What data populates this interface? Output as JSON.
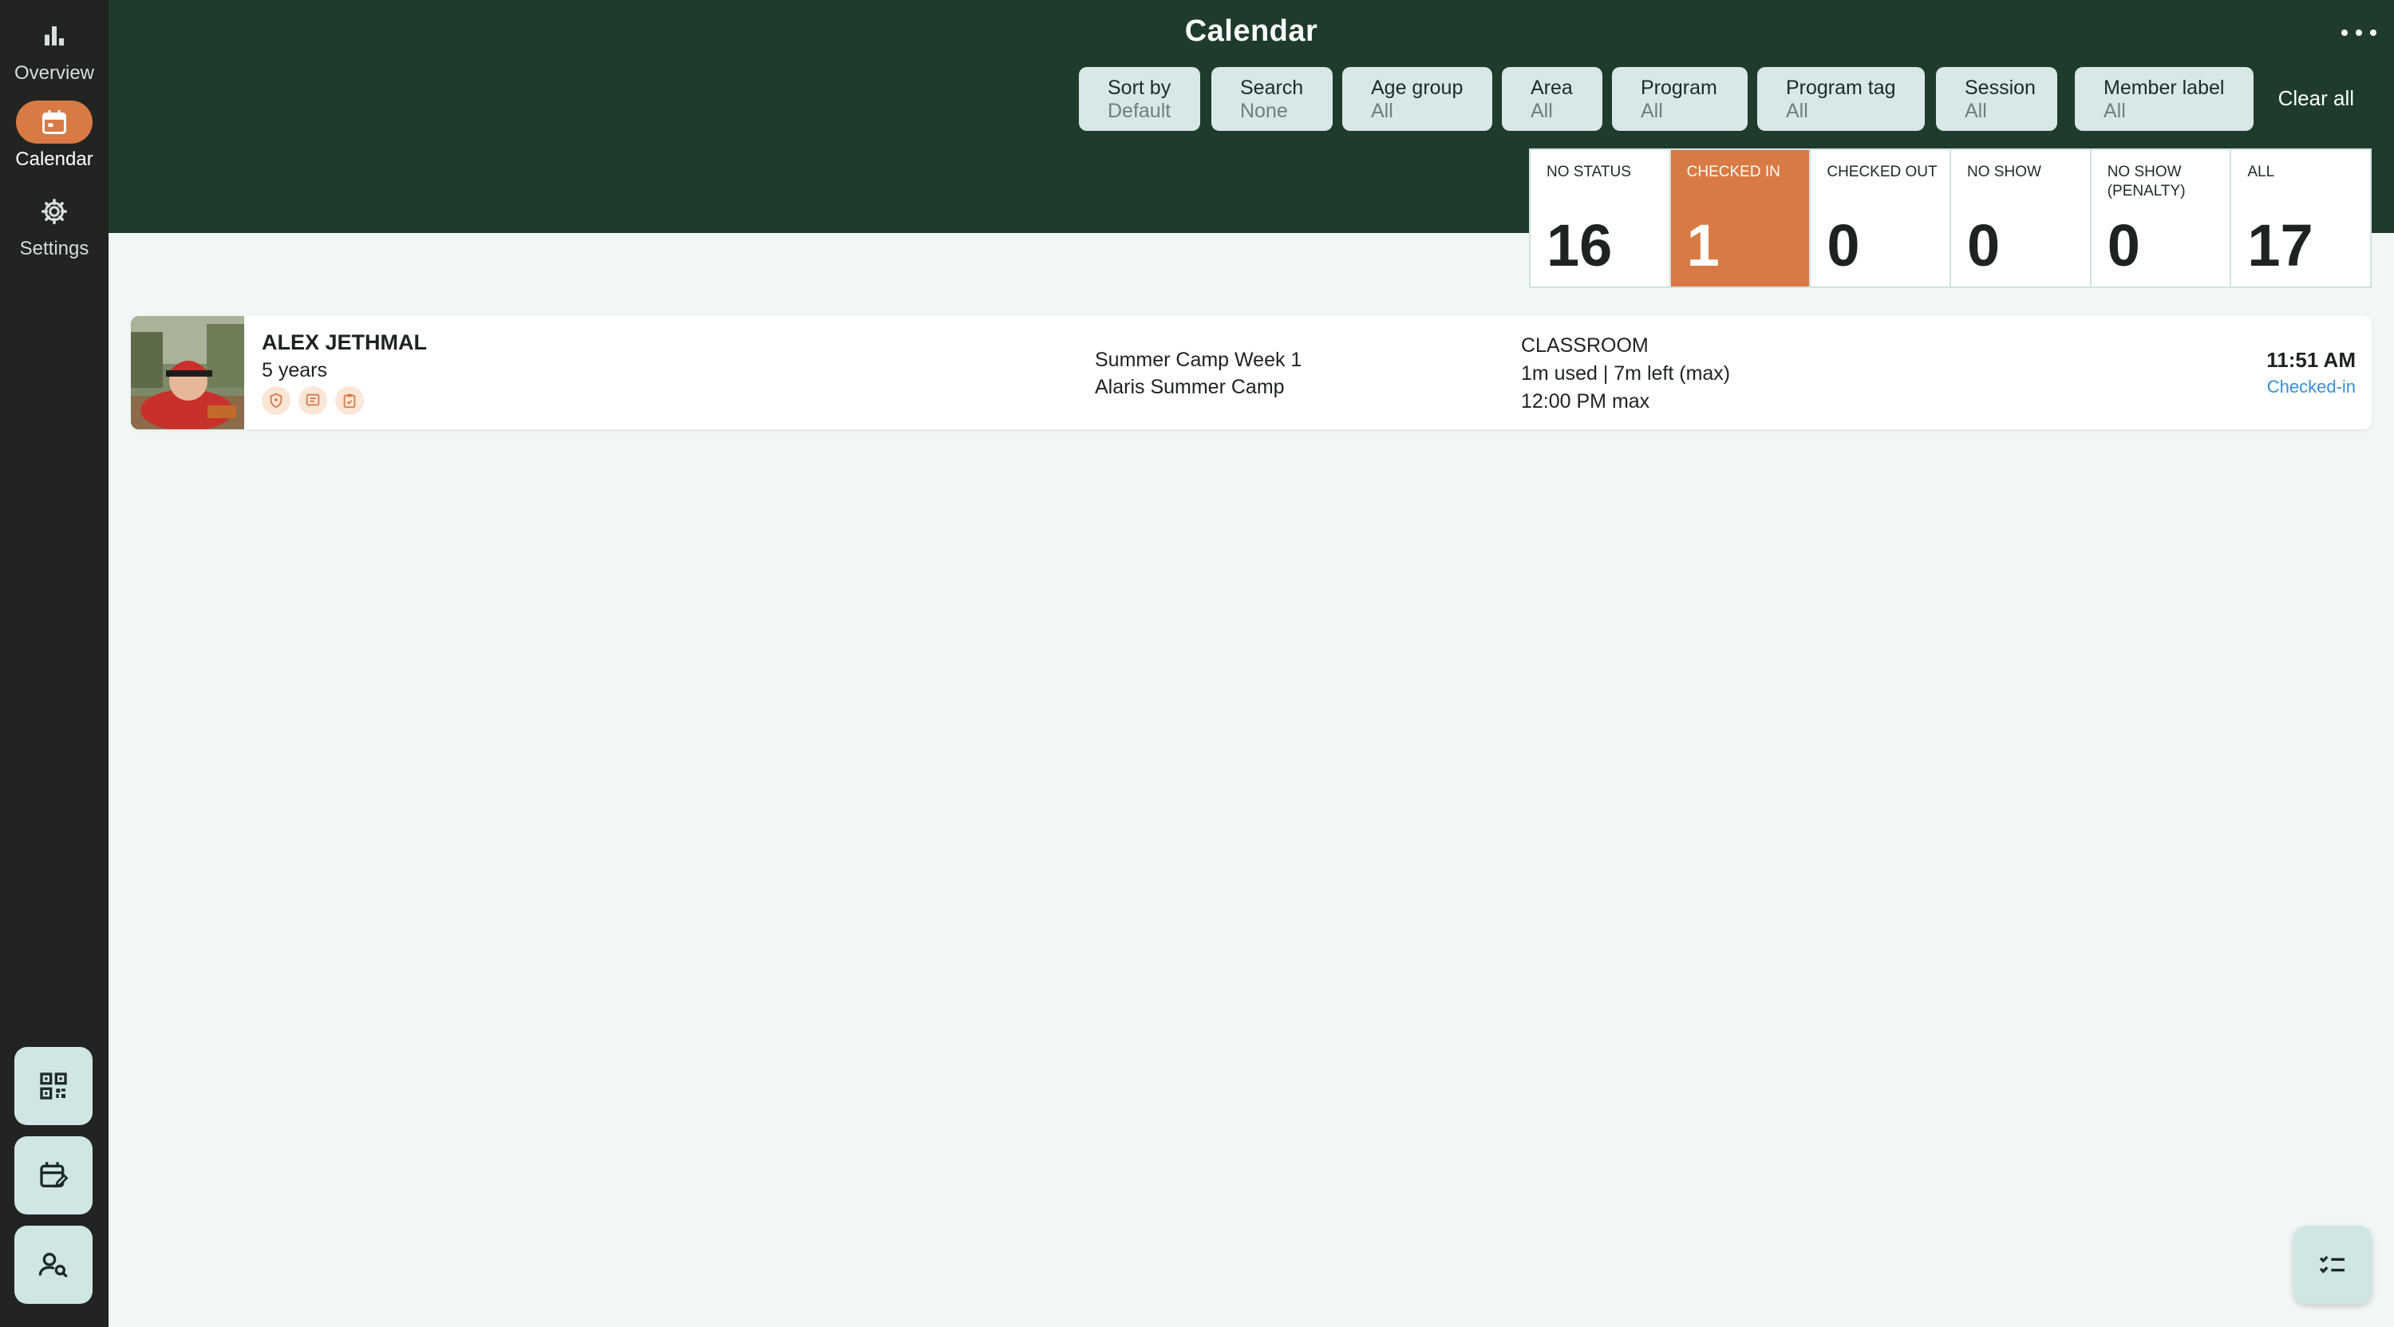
{
  "sidebar": {
    "items": [
      {
        "label": "Overview",
        "icon": "bar-chart-icon"
      },
      {
        "label": "Calendar",
        "icon": "calendar-icon",
        "active": true
      },
      {
        "label": "Settings",
        "icon": "gear-icon"
      }
    ],
    "bottom_buttons": [
      "qr-code-icon",
      "calendar-edit-icon",
      "person-search-icon"
    ]
  },
  "header": {
    "title": "Calendar",
    "filters": [
      {
        "label": "Sort by",
        "value": "Default"
      },
      {
        "label": "Search",
        "value": "None"
      },
      {
        "label": "Age group",
        "value": "All"
      },
      {
        "label": "Area",
        "value": "All"
      },
      {
        "label": "Program",
        "value": "All"
      },
      {
        "label": "Program tag",
        "value": "All"
      },
      {
        "label": "Session",
        "value": "All"
      },
      {
        "label": "Member label",
        "value": "All"
      }
    ],
    "clear_all": "Clear all"
  },
  "status_tiles": [
    {
      "label": "NO STATUS",
      "count": "16"
    },
    {
      "label": "CHECKED IN",
      "count": "1",
      "active": true
    },
    {
      "label": "CHECKED OUT",
      "count": "0"
    },
    {
      "label": "NO SHOW",
      "count": "0"
    },
    {
      "label": "NO SHOW (PENALTY)",
      "count": "0"
    },
    {
      "label": "ALL",
      "count": "17"
    }
  ],
  "rows": [
    {
      "name": "ALEX JETHMAL",
      "age": "5 years",
      "program_line1": "Summer Camp Week 1",
      "program_line2": "Alaris Summer Camp",
      "area": "CLASSROOM",
      "usage": "1m used | 7m left (max)",
      "max_time": "12:00 PM max",
      "time": "11:51 AM",
      "status": "Checked-in"
    }
  ],
  "colors": {
    "sidebar_bg": "#222421",
    "header_bg": "#1e3b2c",
    "accent": "#d97a44",
    "page_bg": "#f1f7f6",
    "status_link": "#3b8ed6"
  }
}
